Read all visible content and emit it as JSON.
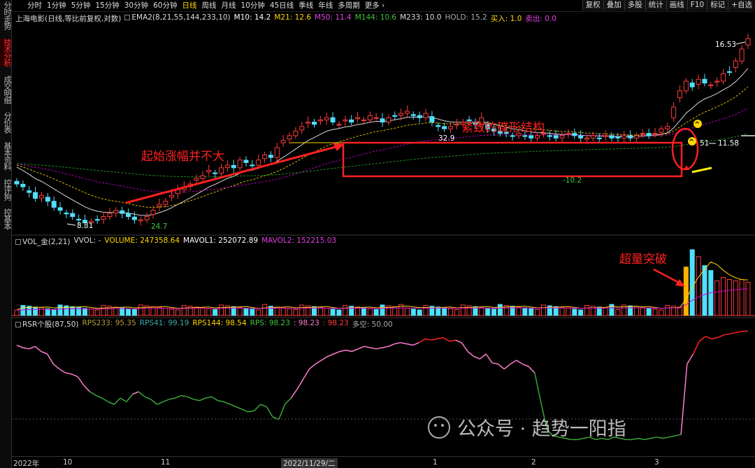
{
  "left_tabs": [
    {
      "label": "分时走势",
      "active": false
    },
    {
      "label": "技术分析",
      "active": true
    },
    {
      "label": "成交明细",
      "active": false
    },
    {
      "label": "分价表",
      "active": false
    },
    {
      "label": "基本资料",
      "active": false
    },
    {
      "label": "控评狗",
      "active": false
    },
    {
      "label": "控基本",
      "active": false
    }
  ],
  "periods": [
    "分时",
    "1分钟",
    "5分钟",
    "15分钟",
    "30分钟",
    "60分钟",
    "日线",
    "周线",
    "月线",
    "10分钟",
    "45日线",
    "季线",
    "年线",
    "多周期",
    "更多 ›"
  ],
  "active_period": "日线",
  "right_buttons": [
    "复权",
    "叠加",
    "多股",
    "统计",
    "画线",
    "F10",
    "标记",
    "+自选"
  ],
  "main_info": {
    "stock": "上海电影",
    "mode": "(日线,等比前复权,对数)",
    "ema_label": "EMA2(8,21,55,144,233,10)",
    "m10": "M10: 14.2",
    "m21": "M21: 12.6",
    "m50": "M50: 11.4",
    "m144": "M144: 10.6",
    "m233": "M233: 10.0",
    "hold": "HOLD: 15.2",
    "buy": "买入: 1.0",
    "sell": "卖出: 0.0"
  },
  "vol_info": {
    "name": "VOL_金(2,21)",
    "vvol": "VVOL: -",
    "volume": "VOLUME: 247358.64",
    "mavol1": "MAVOL1: 252072.89",
    "mavol2": "MAVOL2: 152215.03"
  },
  "rsr_info": {
    "name": "RSR个股(87,50)",
    "rps233": "RPS233: 95.35",
    "rps41": "RPS41: 99.19",
    "rps144": "RPS144: 98.54",
    "rps": "RPS: 98.23",
    "v1": ": 98.23",
    "v2": ": 98.23",
    "duokong": "多空: 50.00"
  },
  "annotations": {
    "left_text": "起始涨幅并不大",
    "box_text": "紧致的碟形结构",
    "break_text": "超量突破",
    "price_high_label": "16.53",
    "price_box_top": "32.9",
    "price_box_low": "-10.2",
    "price_low_label": "8.31",
    "price_low2_label": "24.7",
    "price_breakout": "11.58",
    "price_breakout_prefix": "51"
  },
  "date_axis": {
    "labels": [
      "2022年",
      "10",
      "11",
      "2022/11/29/二",
      "1",
      "2",
      "3"
    ]
  },
  "watermark": "公众号 · 趋势一阳指",
  "colors": {
    "up": "#ff3b3b",
    "down": "#4fe0ff",
    "ema10": "#ffffff",
    "ema21": "#ffd800",
    "ema50": "#d000d0",
    "ema144": "#22aa22",
    "ema233": "#00aa66",
    "rps_high": "#ff2020",
    "rps_mid": "#ff7fd0",
    "rps_low": "#3aa83a"
  },
  "series": {
    "close": [
      9.6,
      9.5,
      9.3,
      9.1,
      9.2,
      9.0,
      8.8,
      8.7,
      8.6,
      8.5,
      8.4,
      8.3,
      8.35,
      8.4,
      8.5,
      8.6,
      8.7,
      8.6,
      8.5,
      8.4,
      8.4,
      8.5,
      8.7,
      8.9,
      9.0,
      9.2,
      9.4,
      9.5,
      9.6,
      9.8,
      9.9,
      10.1,
      10.0,
      10.2,
      10.3,
      10.2,
      10.5,
      10.4,
      10.3,
      10.5,
      10.7,
      10.6,
      11.0,
      11.3,
      11.5,
      11.7,
      11.9,
      12.1,
      12.0,
      12.2,
      12.3,
      12.1,
      12.0,
      12.2,
      12.1,
      12.3,
      12.2,
      12.4,
      12.3,
      12.1,
      12.3,
      12.4,
      12.5,
      12.6,
      12.4,
      12.3,
      12.5,
      12.1,
      11.9,
      11.8,
      11.9,
      12.0,
      12.1,
      12.2,
      12.0,
      12.3,
      11.8,
      11.7,
      11.6,
      11.6,
      11.5,
      11.6,
      11.5,
      11.4,
      11.5,
      11.6,
      11.5,
      11.4,
      11.5,
      11.6,
      11.5,
      11.4,
      11.4,
      11.5,
      11.4,
      11.5,
      11.4,
      11.4,
      11.5,
      11.4,
      11.5,
      11.6,
      11.5,
      11.6,
      11.8,
      11.9,
      12.8,
      13.6,
      14.1,
      13.8,
      14.2,
      14.0,
      13.9,
      14.1,
      14.5,
      14.6,
      15.2,
      15.9,
      16.53
    ],
    "rps": [
      87,
      85,
      84,
      86,
      82,
      80,
      72,
      68,
      65,
      64,
      62,
      55,
      50,
      47,
      45,
      42,
      40,
      45,
      42,
      48,
      50,
      46,
      44,
      40,
      42,
      44,
      45,
      47,
      46,
      44,
      43,
      45,
      46,
      43,
      42,
      40,
      38,
      36,
      34,
      35,
      40,
      38,
      30,
      28,
      40,
      45,
      52,
      60,
      68,
      72,
      75,
      78,
      80,
      82,
      83,
      82,
      84,
      86,
      85,
      84,
      85,
      86,
      88,
      89,
      88,
      87,
      89,
      92,
      91,
      92,
      93,
      90,
      91,
      89,
      82,
      78,
      76,
      80,
      73,
      72,
      68,
      72,
      75,
      72,
      70,
      65,
      42,
      20,
      15,
      14,
      13,
      12,
      12,
      13,
      14,
      12,
      13,
      12,
      14,
      13,
      12,
      12,
      13,
      12,
      13,
      14,
      13,
      14,
      15,
      16,
      72,
      80,
      90,
      94,
      92,
      93,
      95,
      96,
      97,
      98,
      98.23
    ]
  }
}
